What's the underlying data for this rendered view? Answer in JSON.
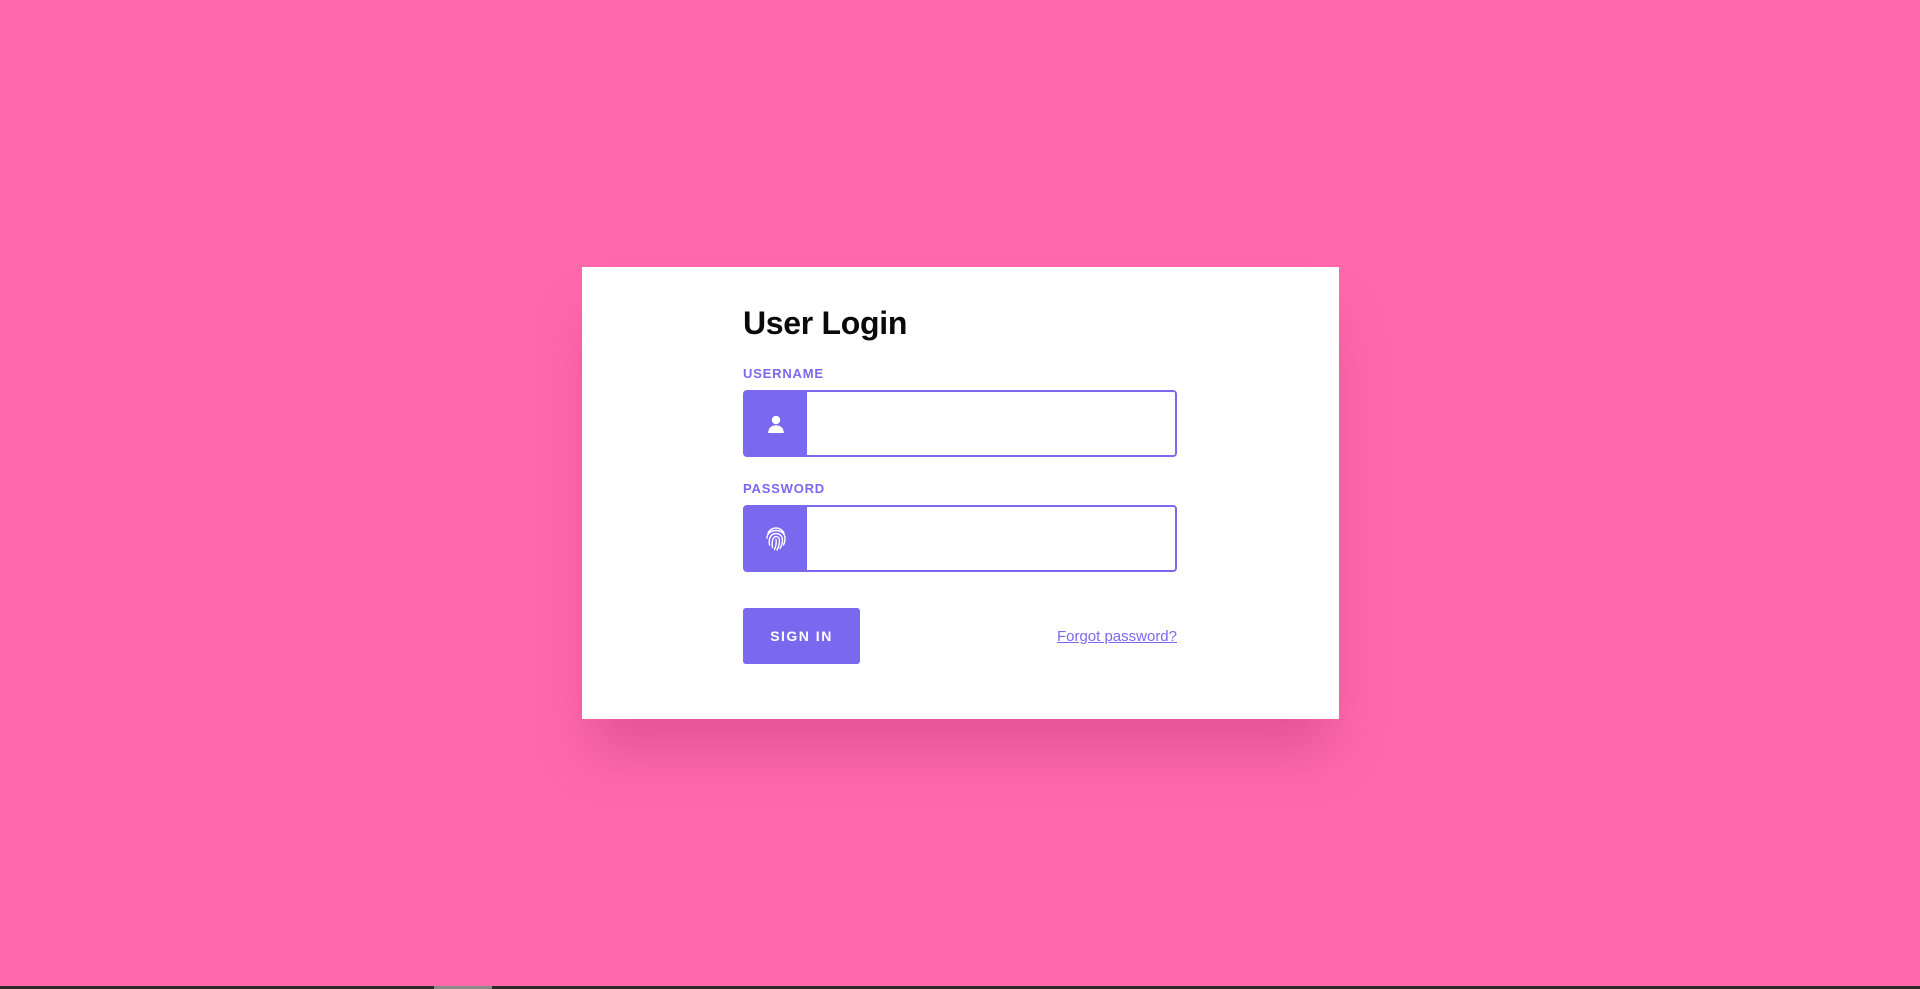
{
  "colors": {
    "background": "#ff69ac",
    "accent": "#7a68ee",
    "card": "#ffffff",
    "title_text": "#0a0a0a"
  },
  "login": {
    "title": "User Login",
    "username": {
      "label": "USERNAME",
      "value": "",
      "icon": "user-icon"
    },
    "password": {
      "label": "PASSWORD",
      "value": "",
      "icon": "fingerprint-icon"
    },
    "signin_label": "SIGN IN",
    "forgot_label": "Forgot password?"
  }
}
